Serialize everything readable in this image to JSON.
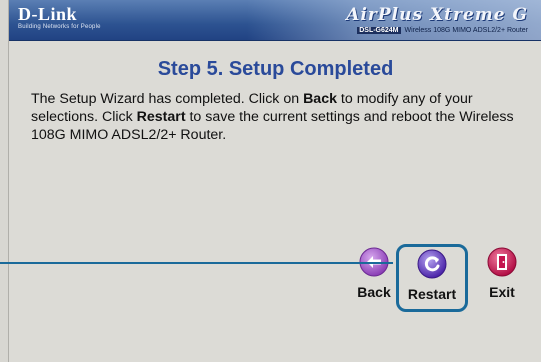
{
  "header": {
    "logo": "D-Link",
    "logo_tagline": "Building Networks for People",
    "brand": "AirPlus Xtreme G",
    "model_badge": "DSL-G624M",
    "model_desc": "Wireless 108G MIMO ADSL2/2+ Router"
  },
  "wizard": {
    "title": "Step 5. Setup Completed",
    "text_1": "The Setup Wizard has completed. Click on ",
    "back_word": "Back",
    "text_2": " to modify any of your selections. Click ",
    "restart_word": "Restart",
    "text_3": " to save the current settings and reboot the Wireless 108G MIMO ADSL2/2+ Router."
  },
  "buttons": {
    "back_label": "Back",
    "restart_label": "Restart",
    "exit_label": "Exit"
  },
  "colors": {
    "header_blue": "#2d5391",
    "title_blue": "#2a4a9a",
    "highlight": "#1a6a9a",
    "back_icon": "#9d4fc4",
    "restart_icon": "#5b36b8",
    "exit_icon": "#c4154f"
  }
}
